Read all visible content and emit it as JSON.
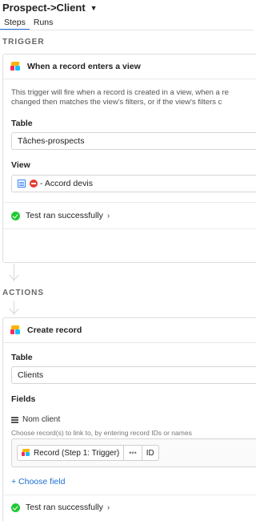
{
  "header": {
    "title": "Prospect->Client",
    "tabs": [
      {
        "label": "Steps",
        "active": true
      },
      {
        "label": "Runs",
        "active": false
      }
    ]
  },
  "trigger": {
    "section_label": "TRIGGER",
    "title": "When a record enters a view",
    "description_line1": "This trigger will fire when a record is created in a view, when a re",
    "description_line2": "changed then matches the view's filters, or if the view's filters c",
    "table_label": "Table",
    "table_value": "Tâches-prospects",
    "view_label": "View",
    "view_value": "- Accord devis",
    "status": "Test ran successfully"
  },
  "actions": {
    "section_label": "ACTIONS",
    "title": "Create record",
    "table_label": "Table",
    "table_value": "Clients",
    "fields_label": "Fields",
    "field_name": "Nom client",
    "field_hint": "Choose record(s) to link to, by entering record IDs or names",
    "token_label": "Record (Step 1: Trigger)",
    "token_dots": "•••",
    "token_field": "ID",
    "choose_field": "+ Choose field",
    "status": "Test ran successfully"
  },
  "icons": {
    "caret": "caret-down-icon",
    "app_logo": "airtable-logo-icon",
    "view": "grid-view-icon",
    "no_entry": "no-entry-emoji",
    "check": "check-circle-icon",
    "chevron": "chevron-right-icon",
    "lines": "long-text-field-icon"
  },
  "colors": {
    "accent_blue": "#1d6fd1",
    "success_green": "#20c933",
    "no_entry_red": "#e53935"
  }
}
